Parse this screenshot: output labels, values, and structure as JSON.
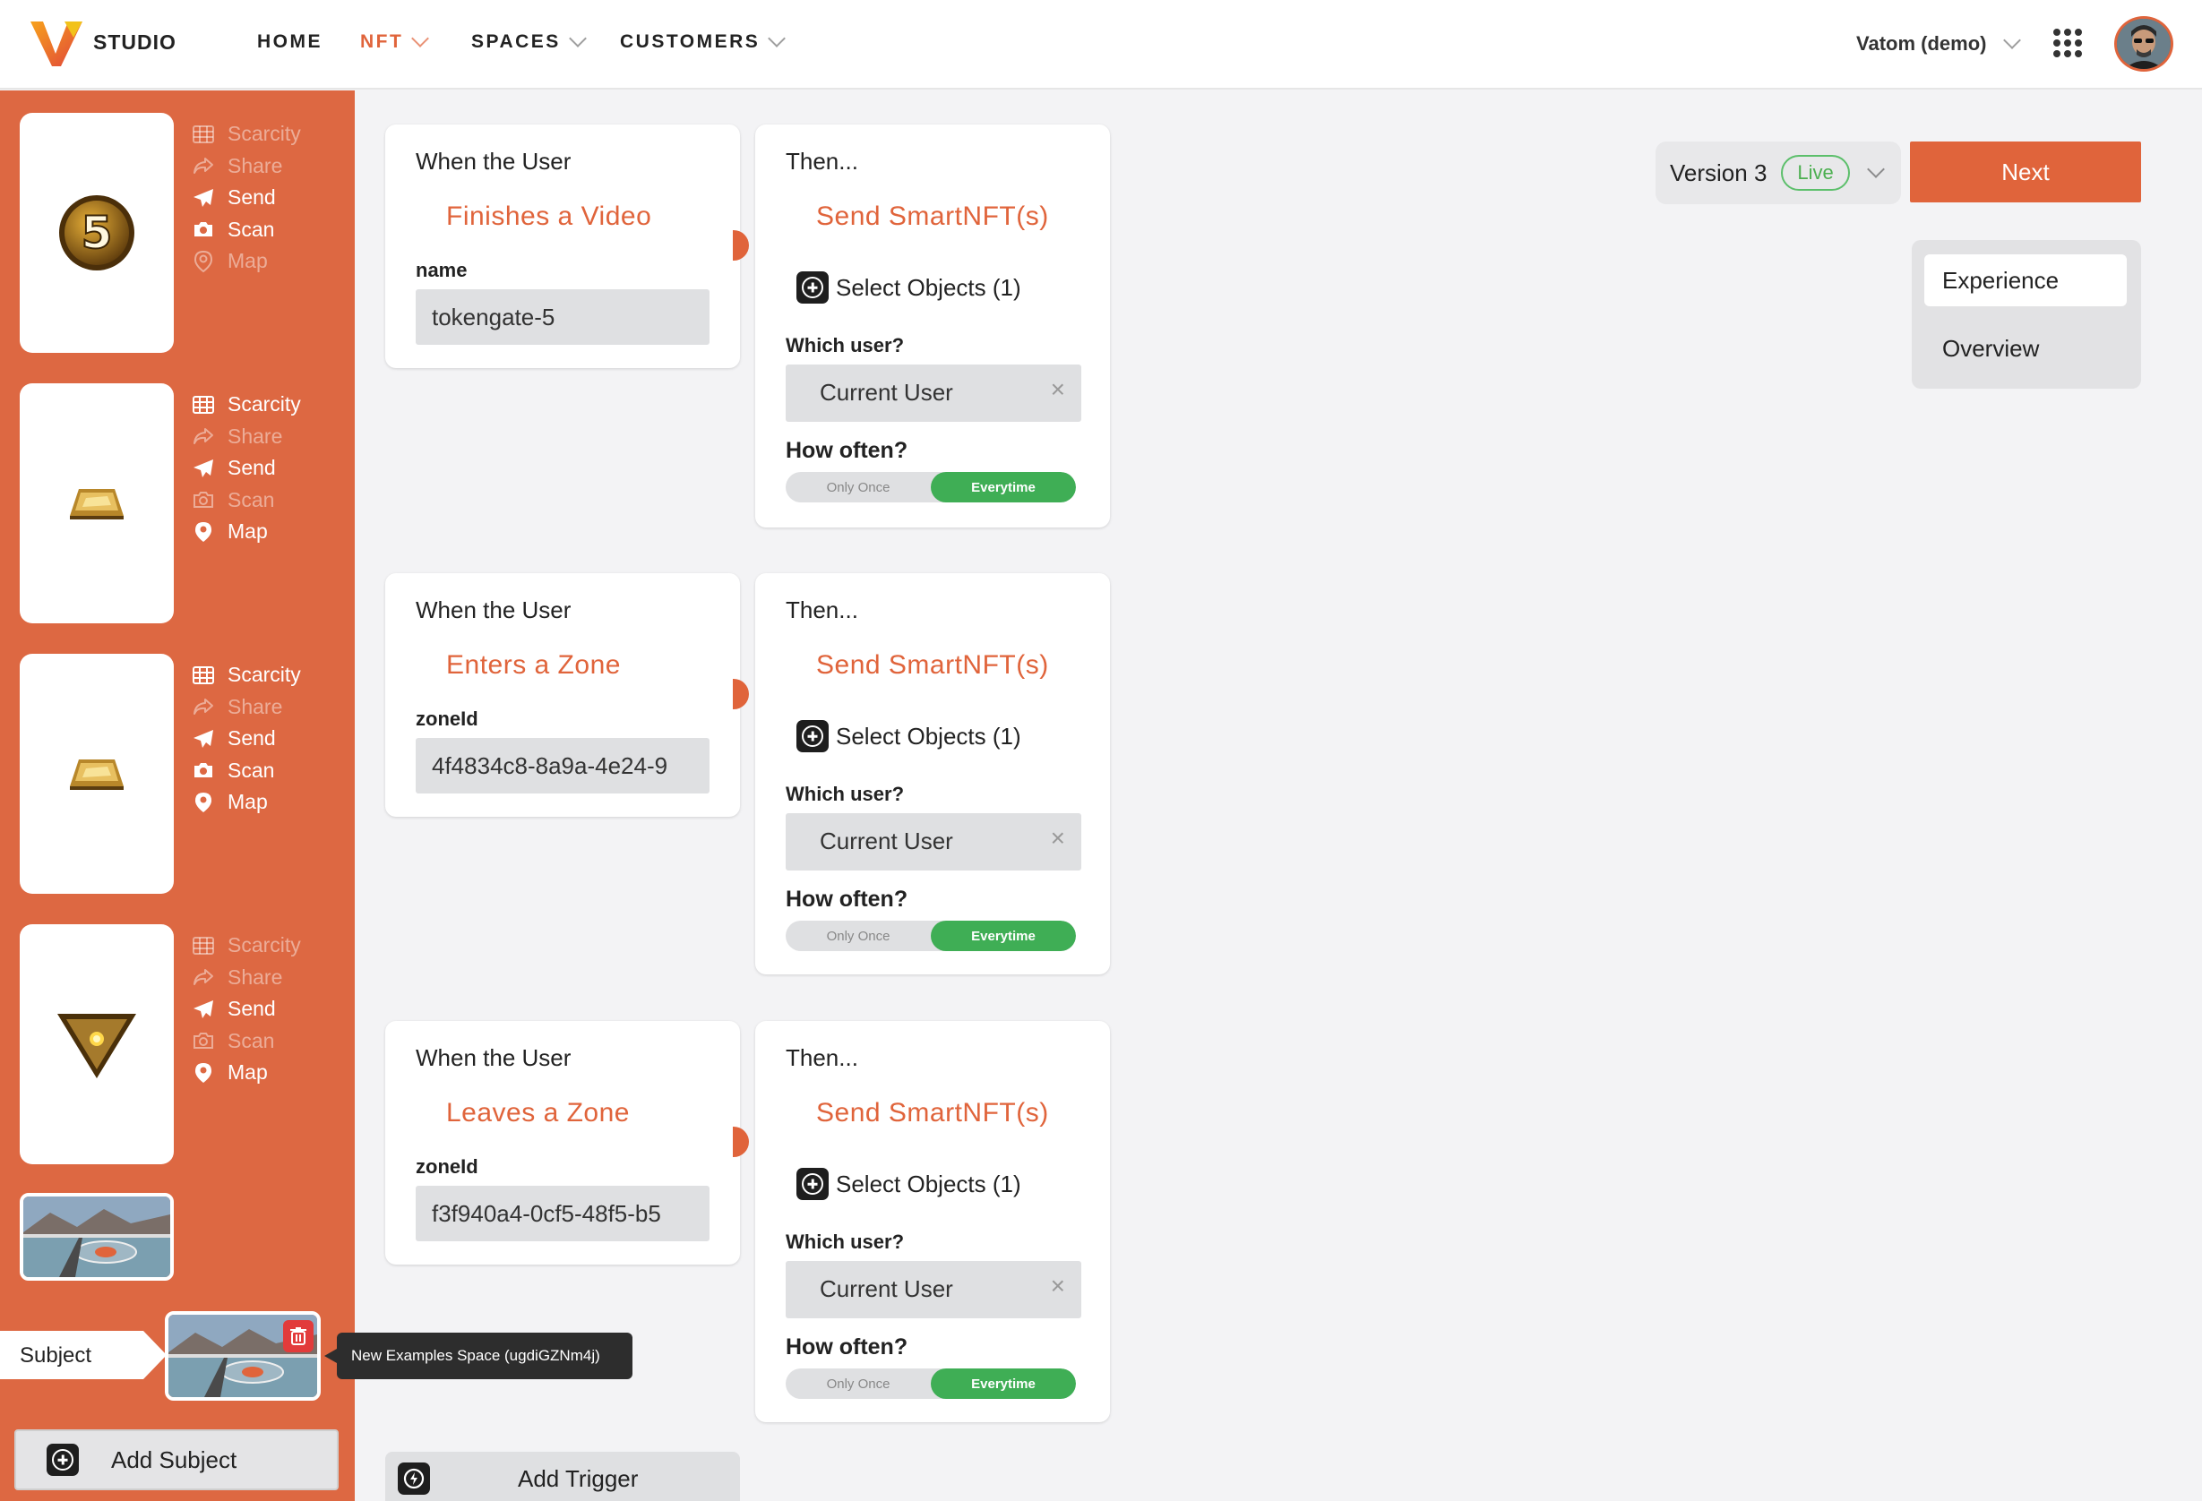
{
  "header": {
    "brand": "STUDIO",
    "nav": [
      {
        "label": "HOME"
      },
      {
        "label": "NFT"
      },
      {
        "label": "SPACES"
      },
      {
        "label": "CUSTOMERS"
      }
    ],
    "account": "Vatom (demo)",
    "accent_color": "#e0643b"
  },
  "sidebar": {
    "objects": [
      {
        "image": "number-5-token-icon",
        "actions": [
          {
            "label": "Scarcity",
            "on": false
          },
          {
            "label": "Share",
            "on": false
          },
          {
            "label": "Send",
            "on": true
          },
          {
            "label": "Scan",
            "on": true
          },
          {
            "label": "Map",
            "on": false
          }
        ]
      },
      {
        "image": "gold-bar-icon",
        "actions": [
          {
            "label": "Scarcity",
            "on": true
          },
          {
            "label": "Share",
            "on": false
          },
          {
            "label": "Send",
            "on": true
          },
          {
            "label": "Scan",
            "on": false
          },
          {
            "label": "Map",
            "on": true
          }
        ]
      },
      {
        "image": "gold-bar-icon",
        "actions": [
          {
            "label": "Scarcity",
            "on": true
          },
          {
            "label": "Share",
            "on": false
          },
          {
            "label": "Send",
            "on": true
          },
          {
            "label": "Scan",
            "on": true
          },
          {
            "label": "Map",
            "on": true
          }
        ]
      },
      {
        "image": "triangle-gem-icon",
        "actions": [
          {
            "label": "Scarcity",
            "on": false
          },
          {
            "label": "Share",
            "on": false
          },
          {
            "label": "Send",
            "on": true
          },
          {
            "label": "Scan",
            "on": false
          },
          {
            "label": "Map",
            "on": true
          }
        ]
      }
    ],
    "subject_label": "Subject",
    "subject_tooltip": "New Examples Space (ugdiGZNm4j)",
    "add_subject": "Add Subject"
  },
  "rules": [
    {
      "trigger_header": "When the User",
      "trigger": "Finishes a Video",
      "field_label": "name",
      "field_value": "tokengate-5",
      "then_header": "Then...",
      "action": "Send SmartNFT(s)",
      "select_objects": "Select Objects (1)",
      "which_user_label": "Which user?",
      "which_user": "Current User",
      "how_often_label": "How often?",
      "often_off": "Only Once",
      "often_on": "Everytime"
    },
    {
      "trigger_header": "When the User",
      "trigger": "Enters a Zone",
      "field_label": "zoneId",
      "field_value": "4f4834c8-8a9a-4e24-9",
      "then_header": "Then...",
      "action": "Send SmartNFT(s)",
      "select_objects": "Select Objects (1)",
      "which_user_label": "Which user?",
      "which_user": "Current User",
      "how_often_label": "How often?",
      "often_off": "Only Once",
      "often_on": "Everytime"
    },
    {
      "trigger_header": "When the User",
      "trigger": "Leaves a Zone",
      "field_label": "zoneId",
      "field_value": "f3f940a4-0cf5-48f5-b5",
      "then_header": "Then...",
      "action": "Send SmartNFT(s)",
      "select_objects": "Select Objects (1)",
      "which_user_label": "Which user?",
      "which_user": "Current User",
      "how_often_label": "How often?",
      "often_off": "Only Once",
      "often_on": "Everytime"
    }
  ],
  "add_trigger": "Add Trigger",
  "version": {
    "label": "Version 3",
    "status": "Live"
  },
  "next_button": "Next",
  "side_tabs": [
    {
      "label": "Experience",
      "selected": true
    },
    {
      "label": "Overview",
      "selected": false
    }
  ]
}
